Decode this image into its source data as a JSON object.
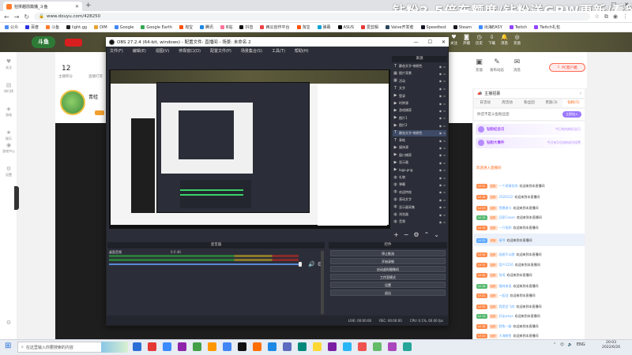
{
  "browser": {
    "tab_title": "狂拼越前篇播_斗鱼",
    "url": "www.douyu.com/428250",
    "watermark": "钻粉2.5倍东额度/钻粉送GPW更新/看留言",
    "bookmarks": [
      {
        "label": "公众",
        "color": "#4c8bf5"
      },
      {
        "label": "百度",
        "color": "#2932e1"
      },
      {
        "label": "斗鱼",
        "color": "#ff7b2c"
      },
      {
        "label": "light.gg",
        "color": "#222222"
      },
      {
        "label": "DIM",
        "color": "#e8a030"
      },
      {
        "label": "Google",
        "color": "#4285f4"
      },
      {
        "label": "Google Earth",
        "color": "#34a853"
      },
      {
        "label": "淘宝",
        "color": "#ff5000"
      },
      {
        "label": "腾讯",
        "color": "#1e88e5"
      },
      {
        "label": "B站",
        "color": "#fb7299"
      },
      {
        "label": "抖音",
        "color": "#111111"
      },
      {
        "label": "西瓜创作平台",
        "color": "#f04142"
      },
      {
        "label": "淘宝",
        "color": "#ff5000"
      },
      {
        "label": "弹幕",
        "color": "#00a1d6"
      },
      {
        "label": "ASUS",
        "color": "#000000"
      },
      {
        "label": "爱剪辑",
        "color": "#e53935"
      },
      {
        "label": "Valve开发者",
        "color": "#2a475e"
      },
      {
        "label": "Speedtest",
        "color": "#141526"
      },
      {
        "label": "Steam",
        "color": "#171a21"
      },
      {
        "label": "出海EASY",
        "color": "#3c8bff"
      },
      {
        "label": "Twitch",
        "color": "#9146ff"
      },
      {
        "label": "Twitch礼包",
        "color": "#9146ff"
      }
    ]
  },
  "douyu": {
    "count_number": "12",
    "count_label": "主播积分",
    "count_b_label": "直播打赏",
    "anchor_name": "青蛙",
    "sidenav": [
      {
        "label": "关注",
        "icon": "heart-icon"
      },
      {
        "label": "排行榜",
        "icon": "rank-icon"
      },
      {
        "label": "游戏",
        "icon": "game-icon"
      },
      {
        "label": "娱乐",
        "icon": "star-icon"
      },
      {
        "label": "游戏中心",
        "icon": "controller-icon"
      },
      {
        "label": "设置",
        "icon": "gear-icon"
      }
    ],
    "right_top": [
      {
        "label": "充值",
        "icon": "wallet-icon"
      },
      {
        "label": "发布动态",
        "icon": "edit-icon"
      },
      {
        "label": "消息",
        "icon": "chat-icon"
      }
    ],
    "pc_button": "PC客户端",
    "header_icons": [
      {
        "label": "关注",
        "icon": "heart-icon"
      },
      {
        "label": "开播",
        "icon": "camera-icon"
      },
      {
        "label": "历史",
        "icon": "clock-icon"
      },
      {
        "label": "下载",
        "icon": "download-icon"
      },
      {
        "label": "消息",
        "icon": "bell-icon"
      },
      {
        "label": "充值",
        "icon": "coin-icon"
      }
    ],
    "lucky_label": "钻粉",
    "owner_label": "主播招募",
    "tabs": [
      "日活动",
      "周活动",
      "粉丝团",
      "贵族(3)",
      "钻粉(5)"
    ],
    "active_tab": 4,
    "fans_text": "你还不是斗鱼粉丝团",
    "fans_btn": "立即加入",
    "notices": [
      {
        "title": "钻粉纪念日",
        "desc": "今日有钻粉纪念日"
      },
      {
        "title": "钻粉大事件",
        "desc": "今日有1位钻粉成功续费"
      }
    ],
    "system_msg": "欢迎进入直播间",
    "chat": [
      {
        "lv": "LV 21",
        "fan": "钻粉",
        "name": "一个表情包呀",
        "text": "欢迎来到本直播间",
        "c": ""
      },
      {
        "lv": "LV 18",
        "fan": "钻粉",
        "name": "2020122",
        "text": "欢迎来到本直播间",
        "c": ""
      },
      {
        "lv": "LV 23",
        "fan": "钻粉",
        "name": "黑暴者卡",
        "text": "欢迎来到本直播间",
        "c": ""
      },
      {
        "lv": "LV 15",
        "fan": "钻粉",
        "name": "回家Cause",
        "text": "欢迎来到本直播间",
        "c": "g"
      },
      {
        "lv": "LV 19",
        "fan": "钻粉",
        "name": "一只斑鸦",
        "text": "欢迎来到本直播间",
        "c": ""
      },
      {
        "lv": "LV 22",
        "fan": "贵族",
        "name": "青爷",
        "text": "欢迎来到本直播间",
        "c": "b"
      },
      {
        "lv": "LV 24",
        "fan": "钻粉",
        "name": "画图不以晚",
        "text": "欢迎来到本直播间",
        "c": ""
      },
      {
        "lv": "LV 17",
        "fan": "钻粉",
        "name": "用户2216",
        "text": "欢迎来到本直播间",
        "c": ""
      },
      {
        "lv": "LV 20",
        "fan": "钻粉",
        "name": "惊涛",
        "text": "欢迎来到本直播间",
        "c": ""
      },
      {
        "lv": "LV 16",
        "fan": "钻粉",
        "name": "猫咪来说",
        "text": "欢迎来到本直播间",
        "c": "g"
      },
      {
        "lv": "LV 21",
        "fan": "钻粉",
        "name": "一起战",
        "text": "欢迎来到本直播间",
        "c": ""
      },
      {
        "lv": "LV 25",
        "fan": "钻粉",
        "name": "我是会飞的",
        "text": "欢迎来到本直播间",
        "c": ""
      },
      {
        "lv": "LV 13",
        "fan": "钻粉",
        "name": "好友wxys",
        "text": "欢迎来到本直播间",
        "c": "g"
      },
      {
        "lv": "LV 18",
        "fan": "钻粉",
        "name": "野兔一路",
        "text": "欢迎来到本直播间",
        "c": ""
      },
      {
        "lv": "LV 22",
        "fan": "钻粉",
        "name": "大海鲸鱼",
        "text": "欢迎来到本直播间",
        "c": ""
      }
    ]
  },
  "obs": {
    "title": "OBS 27.2.4 (64-bit, windows) - 配置文件: 直播间 - 场景: 未命名 2",
    "menu": [
      "文件(F)",
      "编辑(E)",
      "视图(V)",
      "停靠窗口(D)",
      "配置文件(P)",
      "场景集合(S)",
      "工具(T)",
      "帮助(H)"
    ],
    "sources_title": "来源",
    "sources": [
      {
        "icon": "text-icon",
        "glyph": "T",
        "label": "静态文字-带颜色"
      },
      {
        "icon": "scene-icon",
        "glyph": "▦",
        "label": "图片背景"
      },
      {
        "icon": "scene-icon",
        "glyph": "▦",
        "label": "活动"
      },
      {
        "icon": "text-icon",
        "glyph": "T",
        "label": "文字"
      },
      {
        "icon": "play-icon",
        "glyph": "▶",
        "label": "登录"
      },
      {
        "icon": "play-icon",
        "glyph": "▶",
        "label": "时钟源"
      },
      {
        "icon": "play-icon",
        "glyph": "▶",
        "label": "游戏捕获"
      },
      {
        "icon": "play-icon",
        "glyph": "▶",
        "label": "图片1"
      },
      {
        "icon": "play-icon",
        "glyph": "▶",
        "label": "图片2"
      },
      {
        "icon": "text-icon",
        "glyph": "T",
        "label": "静态文字-带颜色"
      },
      {
        "icon": "text-icon",
        "glyph": "T",
        "label": "青蛙"
      },
      {
        "icon": "play-icon",
        "glyph": "▶",
        "label": "媒体源"
      },
      {
        "icon": "play-icon",
        "glyph": "▶",
        "label": "窗口捕获"
      },
      {
        "icon": "play-icon",
        "glyph": "▶",
        "label": "显示器"
      },
      {
        "icon": "play-icon",
        "glyph": "▶",
        "label": "logo.png"
      },
      {
        "icon": "globe-icon",
        "glyph": "◍",
        "label": "礼物"
      },
      {
        "icon": "globe-icon",
        "glyph": "◍",
        "label": "弹幕"
      },
      {
        "icon": "globe-icon",
        "glyph": "◍",
        "label": "欢迎特效"
      },
      {
        "icon": "globe-icon",
        "glyph": "◍",
        "label": "滚动文字"
      },
      {
        "icon": "globe-icon",
        "glyph": "◍",
        "label": "显示器采集"
      },
      {
        "icon": "globe-icon",
        "glyph": "◍",
        "label": "浏览器"
      },
      {
        "icon": "globe-icon",
        "glyph": "◍",
        "label": "音频"
      }
    ],
    "selected_source": 9,
    "mixer_title": "混音器",
    "mixer_label": "桌面音频",
    "mixer_db": "0.0 dB",
    "controls_title": "控件",
    "controls": [
      "停止推流",
      "开始录制",
      "启动虚拟摄像机",
      "工作室模式",
      "设置",
      "退出"
    ],
    "status": [
      "LIVE: 00:00:00",
      "REC: 00:00:00",
      "CPU: 0.1%, 60.00 fps"
    ]
  },
  "taskbar": {
    "search_placeholder": "在这里输入你要搜索的内容",
    "apps": [
      "#2b6fd6",
      "#e53935",
      "#3c8bff",
      "#8e24aa",
      "#43a047",
      "#ff9800",
      "#4285f4",
      "#111111",
      "#ff6f00",
      "#1e88e5",
      "#5c6bc0",
      "#00897b",
      "#fdd835",
      "#7b1fa2",
      "#29b6f6",
      "#ef5350",
      "#66bb6a",
      "#ab47bc",
      "#26a69a"
    ],
    "lang": "ENG",
    "time": "20:03",
    "date": "2022/6/26"
  }
}
